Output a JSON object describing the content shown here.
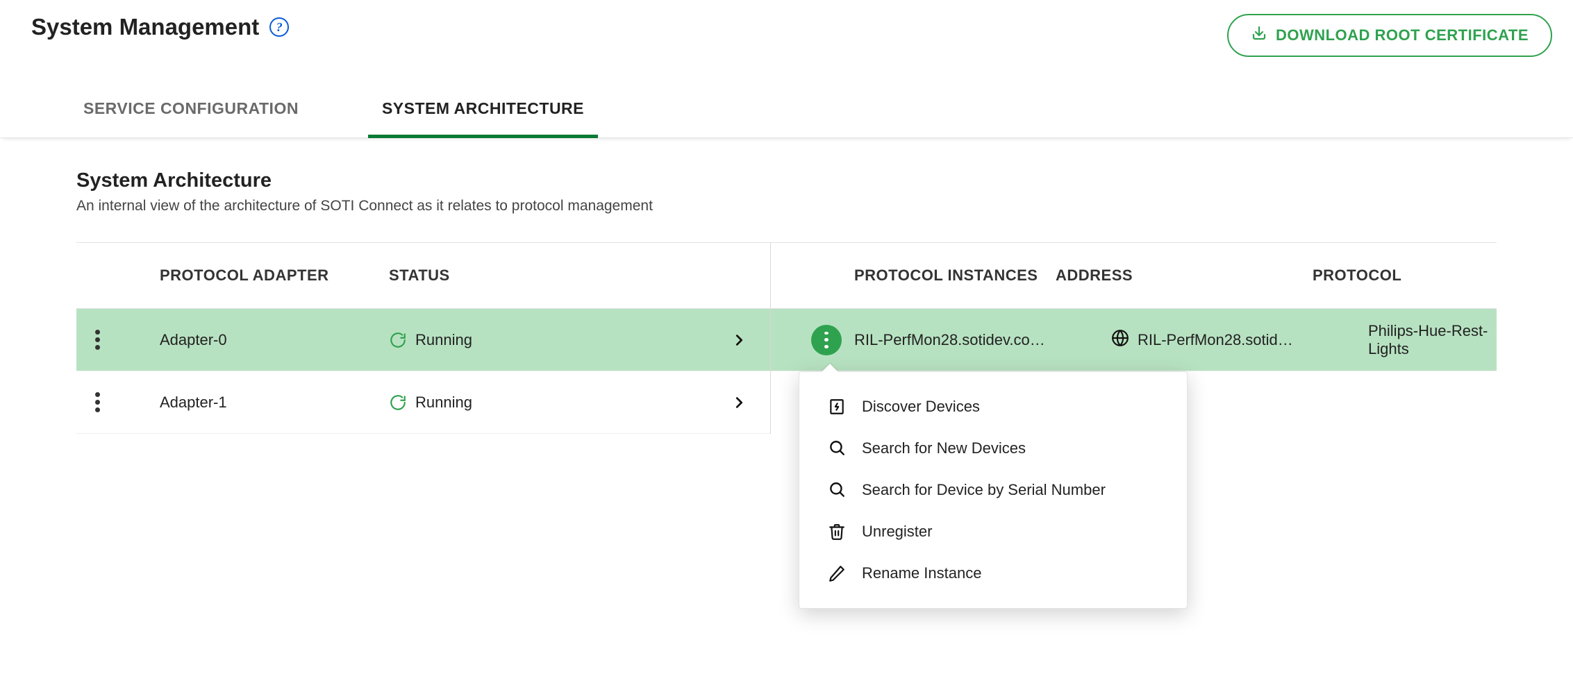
{
  "header": {
    "title": "System Management",
    "download_label": "DOWNLOAD ROOT CERTIFICATE"
  },
  "tabs": [
    {
      "label": "SERVICE CONFIGURATION",
      "active": false
    },
    {
      "label": "SYSTEM ARCHITECTURE",
      "active": true
    }
  ],
  "section": {
    "title": "System Architecture",
    "description": "An internal view of the architecture of SOTI Connect as it relates to protocol management"
  },
  "left": {
    "col_adapter": "PROTOCOL ADAPTER",
    "col_status": "STATUS",
    "rows": [
      {
        "name": "Adapter-0",
        "status": "Running",
        "selected": true
      },
      {
        "name": "Adapter-1",
        "status": "Running",
        "selected": false
      }
    ]
  },
  "right": {
    "col_inst": "PROTOCOL INSTANCES",
    "col_addr": "ADDRESS",
    "col_proto": "PROTOCOL",
    "rows": [
      {
        "instance": "RIL-PerfMon28.sotidev.co…",
        "address": "RIL-PerfMon28.sotid…",
        "protocol": "Philips-Hue-Rest-Lights",
        "selected": true
      }
    ]
  },
  "context_menu": {
    "items": [
      {
        "icon": "bolt-icon",
        "label": "Discover Devices"
      },
      {
        "icon": "search-icon",
        "label": "Search for New Devices"
      },
      {
        "icon": "search-icon",
        "label": "Search for Device by Serial Number"
      },
      {
        "icon": "trash-icon",
        "label": "Unregister"
      },
      {
        "icon": "pencil-icon",
        "label": "Rename Instance"
      }
    ]
  },
  "colors": {
    "accent_green": "#2fa24f",
    "accent_green_dark": "#0b7a35",
    "selection_green": "#b7e2c1",
    "link_blue": "#0a5bd6"
  }
}
